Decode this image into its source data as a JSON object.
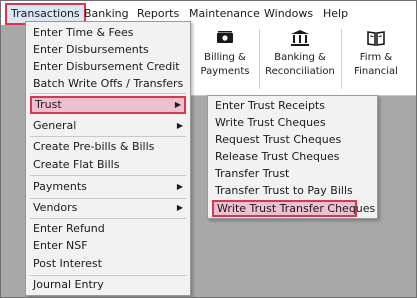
{
  "menubar": {
    "items": [
      "Transactions",
      "Banking",
      "Reports",
      "Maintenance",
      "Windows",
      "Help"
    ]
  },
  "toolbar": {
    "billing_label_1": "Billing &",
    "billing_label_2": "Payments",
    "banking_label_1": "Banking &",
    "banking_label_2": "Reconciliation",
    "firm_label_1": "Firm &",
    "firm_label_2": "Financial"
  },
  "transactions_menu": {
    "items": [
      "Enter Time & Fees",
      "Enter Disbursements",
      "Enter Disbursement Credit",
      "Batch Write Offs / Transfers",
      "Trust",
      "General",
      "Create Pre-bills & Bills",
      "Create Flat Bills",
      "Payments",
      "Vendors",
      "Enter Refund",
      "Enter NSF",
      "Post Interest",
      "Journal Entry"
    ],
    "submenu_arrow": "▶"
  },
  "trust_submenu": {
    "items": [
      "Enter Trust Receipts",
      "Write Trust Cheques",
      "Request Trust Cheques",
      "Release Trust Cheques",
      "Transfer Trust",
      "Transfer Trust to Pay Bills",
      "Write Trust Transfer Cheques"
    ]
  }
}
